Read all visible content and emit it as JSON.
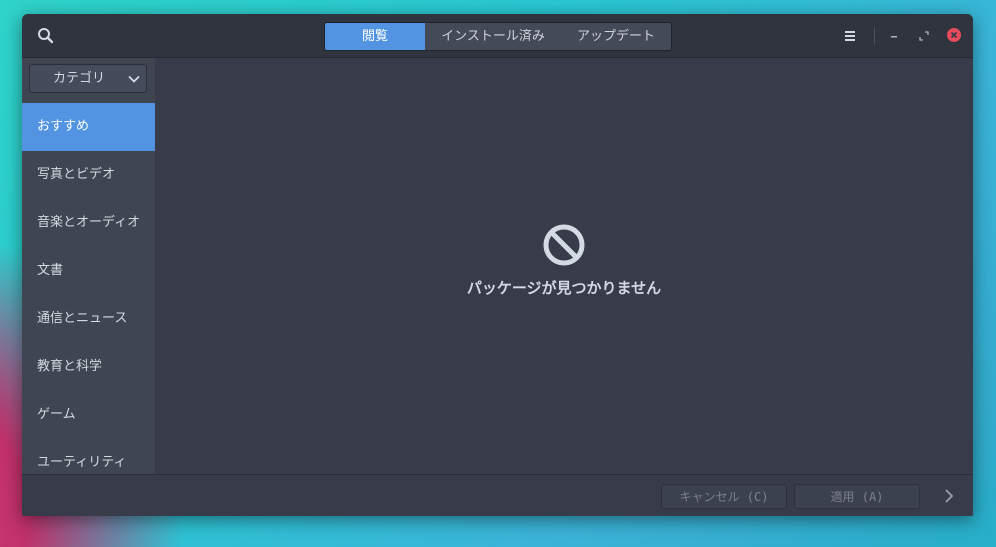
{
  "header": {
    "tabs": [
      {
        "label": "閲覧",
        "active": true
      },
      {
        "label": "インストール済み",
        "active": false
      },
      {
        "label": "アップデート",
        "active": false
      }
    ]
  },
  "sidebar": {
    "category_select": "カテゴリ",
    "items": [
      {
        "label": "おすすめ",
        "selected": true
      },
      {
        "label": "写真とビデオ"
      },
      {
        "label": "音楽とオーディオ"
      },
      {
        "label": "文書"
      },
      {
        "label": "通信とニュース"
      },
      {
        "label": "教育と科学"
      },
      {
        "label": "ゲーム"
      },
      {
        "label": "ユーティリティ"
      }
    ]
  },
  "content": {
    "empty_message": "パッケージが見つかりません"
  },
  "footer": {
    "cancel_label": "キャンセル (C)",
    "apply_label": "適用 (A)"
  },
  "colors": {
    "accent": "#5294e2",
    "header_bg": "#2f343f",
    "sidebar_bg": "#404552",
    "content_bg": "#383c4a",
    "close": "#e74c5c"
  }
}
